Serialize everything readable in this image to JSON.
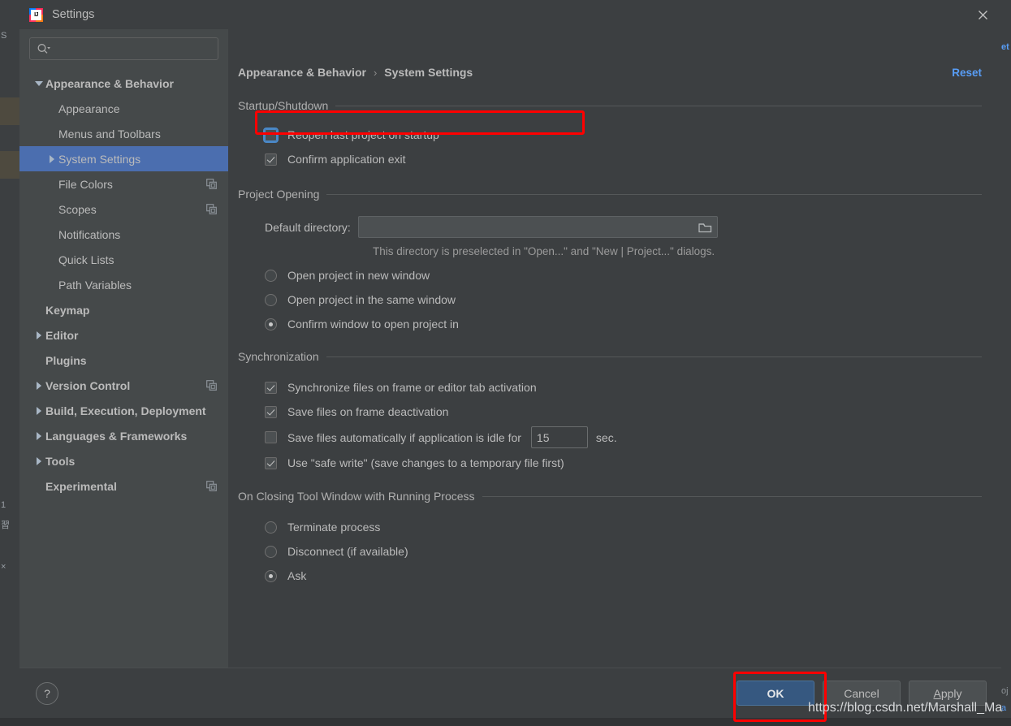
{
  "window": {
    "title": "Settings",
    "logo_text": "IJ",
    "close_icon": "close-icon"
  },
  "sidebar": {
    "search": {
      "value": "",
      "placeholder": "",
      "icon": "search-icon"
    },
    "items": [
      {
        "label": "Appearance & Behavior",
        "indent": 0,
        "arrow": "down",
        "bold": true,
        "selected": false,
        "copy_icon": false
      },
      {
        "label": "Appearance",
        "indent": 1,
        "arrow": "none",
        "bold": false,
        "selected": false,
        "copy_icon": false
      },
      {
        "label": "Menus and Toolbars",
        "indent": 1,
        "arrow": "none",
        "bold": false,
        "selected": false,
        "copy_icon": false
      },
      {
        "label": "System Settings",
        "indent": 1,
        "arrow": "right",
        "bold": false,
        "selected": true,
        "copy_icon": false
      },
      {
        "label": "File Colors",
        "indent": 1,
        "arrow": "none",
        "bold": false,
        "selected": false,
        "copy_icon": true
      },
      {
        "label": "Scopes",
        "indent": 1,
        "arrow": "none",
        "bold": false,
        "selected": false,
        "copy_icon": true
      },
      {
        "label": "Notifications",
        "indent": 1,
        "arrow": "none",
        "bold": false,
        "selected": false,
        "copy_icon": false
      },
      {
        "label": "Quick Lists",
        "indent": 1,
        "arrow": "none",
        "bold": false,
        "selected": false,
        "copy_icon": false
      },
      {
        "label": "Path Variables",
        "indent": 1,
        "arrow": "none",
        "bold": false,
        "selected": false,
        "copy_icon": false
      },
      {
        "label": "Keymap",
        "indent": 0,
        "arrow": "none",
        "bold": true,
        "selected": false,
        "copy_icon": false
      },
      {
        "label": "Editor",
        "indent": 0,
        "arrow": "right",
        "bold": true,
        "selected": false,
        "copy_icon": false
      },
      {
        "label": "Plugins",
        "indent": 0,
        "arrow": "none",
        "bold": true,
        "selected": false,
        "copy_icon": false
      },
      {
        "label": "Version Control",
        "indent": 0,
        "arrow": "right",
        "bold": true,
        "selected": false,
        "copy_icon": true
      },
      {
        "label": "Build, Execution, Deployment",
        "indent": 0,
        "arrow": "right",
        "bold": true,
        "selected": false,
        "copy_icon": false
      },
      {
        "label": "Languages & Frameworks",
        "indent": 0,
        "arrow": "right",
        "bold": true,
        "selected": false,
        "copy_icon": false
      },
      {
        "label": "Tools",
        "indent": 0,
        "arrow": "right",
        "bold": true,
        "selected": false,
        "copy_icon": false
      },
      {
        "label": "Experimental",
        "indent": 0,
        "arrow": "none",
        "bold": true,
        "selected": false,
        "copy_icon": true
      }
    ]
  },
  "header": {
    "breadcrumb_parent": "Appearance & Behavior",
    "breadcrumb_separator": "›",
    "breadcrumb_current": "System Settings",
    "reset_label": "Reset"
  },
  "sections": {
    "startup": {
      "title": "Startup/Shutdown",
      "reopen_last_project": {
        "label": "Reopen last project on startup",
        "checked": false,
        "focused": true
      },
      "confirm_exit": {
        "label": "Confirm application exit",
        "checked": true
      }
    },
    "project_opening": {
      "title": "Project Opening",
      "default_directory_label": "Default directory:",
      "default_directory_value": "",
      "default_directory_placeholder": "",
      "browse_icon": "folder-icon",
      "hint": "This directory is preselected in \"Open...\" and \"New | Project...\" dialogs.",
      "options": [
        {
          "label": "Open project in new window",
          "selected": false
        },
        {
          "label": "Open project in the same window",
          "selected": false
        },
        {
          "label": "Confirm window to open project in",
          "selected": true
        }
      ]
    },
    "synchronization": {
      "title": "Synchronization",
      "sync_on_activation": {
        "label": "Synchronize files on frame or editor tab activation",
        "checked": true
      },
      "save_on_deactivation": {
        "label": "Save files on frame deactivation",
        "checked": true
      },
      "autosave_idle": {
        "label": "Save files automatically if application is idle for",
        "checked": false,
        "value": "15",
        "unit": "sec."
      },
      "safe_write": {
        "label": "Use \"safe write\" (save changes to a temporary file first)",
        "checked": true
      }
    },
    "closing_tool_window": {
      "title": "On Closing Tool Window with Running Process",
      "options": [
        {
          "label": "Terminate process",
          "selected": false
        },
        {
          "label": "Disconnect (if available)",
          "selected": false
        },
        {
          "label": "Ask",
          "selected": true
        }
      ]
    }
  },
  "footer": {
    "help_label": "?",
    "ok_label": "OK",
    "cancel_label": "Cancel",
    "apply_mnemonic": "A",
    "apply_rest": "pply"
  },
  "watermark": "https://blog.csdn.net/Marshall_Ma",
  "background": {
    "left_texts": [
      "S",
      "1",
      "習",
      "×"
    ],
    "right_texts": [
      "et",
      "oj",
      "a",
      "Ma"
    ]
  },
  "colors": {
    "accent_selection": "#4b6eaf",
    "link": "#589df6",
    "annotation": "#ff0000",
    "primary_button": "#365880",
    "dialog_bg": "#3c3f41",
    "sidebar_bg": "#45494a"
  }
}
